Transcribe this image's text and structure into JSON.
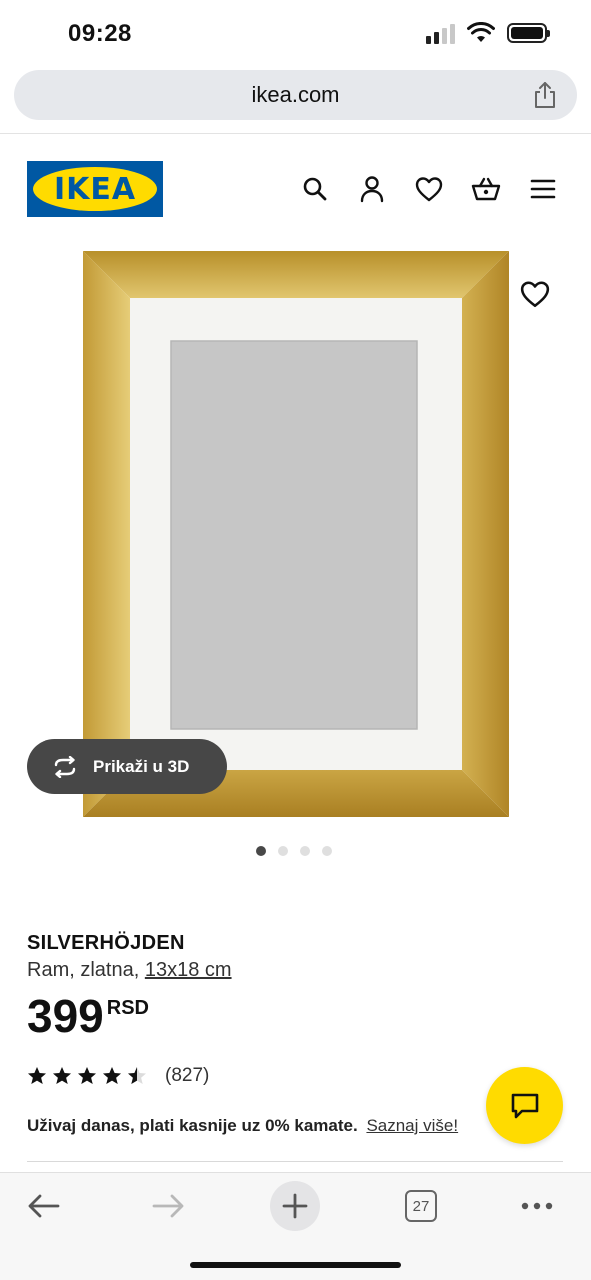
{
  "status_bar": {
    "time": "09:28"
  },
  "browser": {
    "url": "ikea.com",
    "tab_count": "27"
  },
  "header": {
    "logo_text": "IKEA",
    "icons": [
      "search-icon",
      "account-icon",
      "heart-icon",
      "cart-icon",
      "menu-icon"
    ]
  },
  "product": {
    "name": "SILVERHÖJDEN",
    "description": "Ram, zlatna,",
    "size": "13x18 cm",
    "price": "399",
    "currency": "RSD",
    "rating_value": 4.5,
    "rating_max": 5,
    "review_count": "(827)",
    "view_3d_label": "Prikaži u 3D",
    "image_count": 4,
    "active_image": 1
  },
  "finance": {
    "text": "Uživaj danas, plati kasnije uz 0% kamate.",
    "link": "Saznaj više!"
  },
  "colors": {
    "ikea_blue": "#0058a3",
    "ikea_yellow": "#ffdb00",
    "frame_gold": "#c9a33a"
  }
}
